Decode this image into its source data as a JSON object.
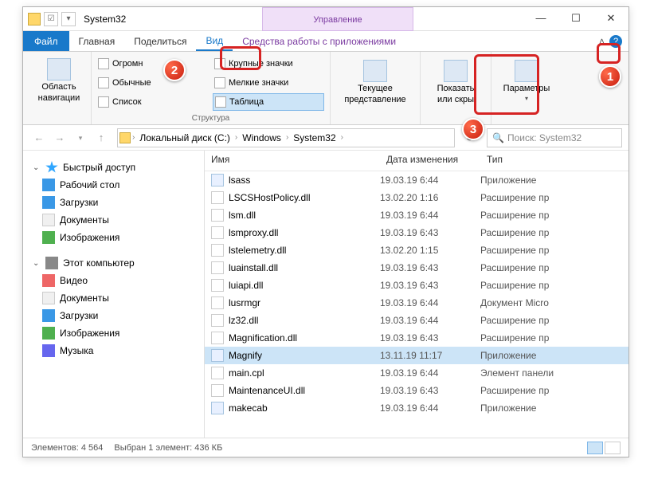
{
  "title": "System32",
  "contextual_tab": "Управление",
  "tabs": {
    "file": "Файл",
    "home": "Главная",
    "share": "Поделиться",
    "view": "Вид",
    "apptools": "Средства работы с приложениями"
  },
  "ribbon": {
    "nav_panes": {
      "l1": "Область",
      "l2": "навигации"
    },
    "layouts": {
      "xl": "Огромн",
      "med": "Обычные",
      "list": "Список",
      "large": "Крупные значки",
      "small": "Мелкие значки",
      "details": "Таблица",
      "group_label": "Структура"
    },
    "current_view": {
      "l1": "Текущее",
      "l2": "представление"
    },
    "show_hide": {
      "l1": "Показать",
      "l2": "или скры"
    },
    "options": "Параметры"
  },
  "breadcrumbs": [
    "Локальный диск (C:)",
    "Windows",
    "System32"
  ],
  "search_placeholder": "Поиск: System32",
  "nav": {
    "quick": "Быстрый доступ",
    "desktop": "Рабочий стол",
    "downloads": "Загрузки",
    "documents": "Документы",
    "pictures": "Изображения",
    "thispc": "Этот компьютер",
    "video": "Видео",
    "documents2": "Документы",
    "downloads2": "Загрузки",
    "pictures2": "Изображения",
    "music": "Музыка"
  },
  "columns": {
    "name": "Имя",
    "date": "Дата изменения",
    "type": "Тип"
  },
  "rows": [
    {
      "name": "lsass",
      "date": "19.03.19 6:44",
      "type": "Приложение",
      "icon": "exe",
      "sel": false
    },
    {
      "name": "LSCSHostPolicy.dll",
      "date": "13.02.20 1:16",
      "type": "Расширение пр",
      "icon": "dll",
      "sel": false
    },
    {
      "name": "lsm.dll",
      "date": "19.03.19 6:44",
      "type": "Расширение пр",
      "icon": "dll",
      "sel": false
    },
    {
      "name": "lsmproxy.dll",
      "date": "19.03.19 6:43",
      "type": "Расширение пр",
      "icon": "dll",
      "sel": false
    },
    {
      "name": "lstelemetry.dll",
      "date": "13.02.20 1:15",
      "type": "Расширение пр",
      "icon": "dll",
      "sel": false
    },
    {
      "name": "luainstall.dll",
      "date": "19.03.19 6:43",
      "type": "Расширение пр",
      "icon": "dll",
      "sel": false
    },
    {
      "name": "luiapi.dll",
      "date": "19.03.19 6:43",
      "type": "Расширение пр",
      "icon": "dll",
      "sel": false
    },
    {
      "name": "lusrmgr",
      "date": "19.03.19 6:44",
      "type": "Документ Micro",
      "icon": "dll",
      "sel": false
    },
    {
      "name": "lz32.dll",
      "date": "19.03.19 6:44",
      "type": "Расширение пр",
      "icon": "dll",
      "sel": false
    },
    {
      "name": "Magnification.dll",
      "date": "19.03.19 6:43",
      "type": "Расширение пр",
      "icon": "dll",
      "sel": false
    },
    {
      "name": "Magnify",
      "date": "13.11.19 11:17",
      "type": "Приложение",
      "icon": "exe",
      "sel": true
    },
    {
      "name": "main.cpl",
      "date": "19.03.19 6:44",
      "type": "Элемент панели",
      "icon": "dll",
      "sel": false
    },
    {
      "name": "MaintenanceUI.dll",
      "date": "19.03.19 6:43",
      "type": "Расширение пр",
      "icon": "dll",
      "sel": false
    },
    {
      "name": "makecab",
      "date": "19.03.19 6:44",
      "type": "Приложение",
      "icon": "exe",
      "sel": false
    }
  ],
  "status": {
    "count": "Элементов: 4 564",
    "selection": "Выбран 1 элемент: 436 КБ"
  },
  "badges": {
    "b1": "1",
    "b2": "2",
    "b3": "3"
  }
}
